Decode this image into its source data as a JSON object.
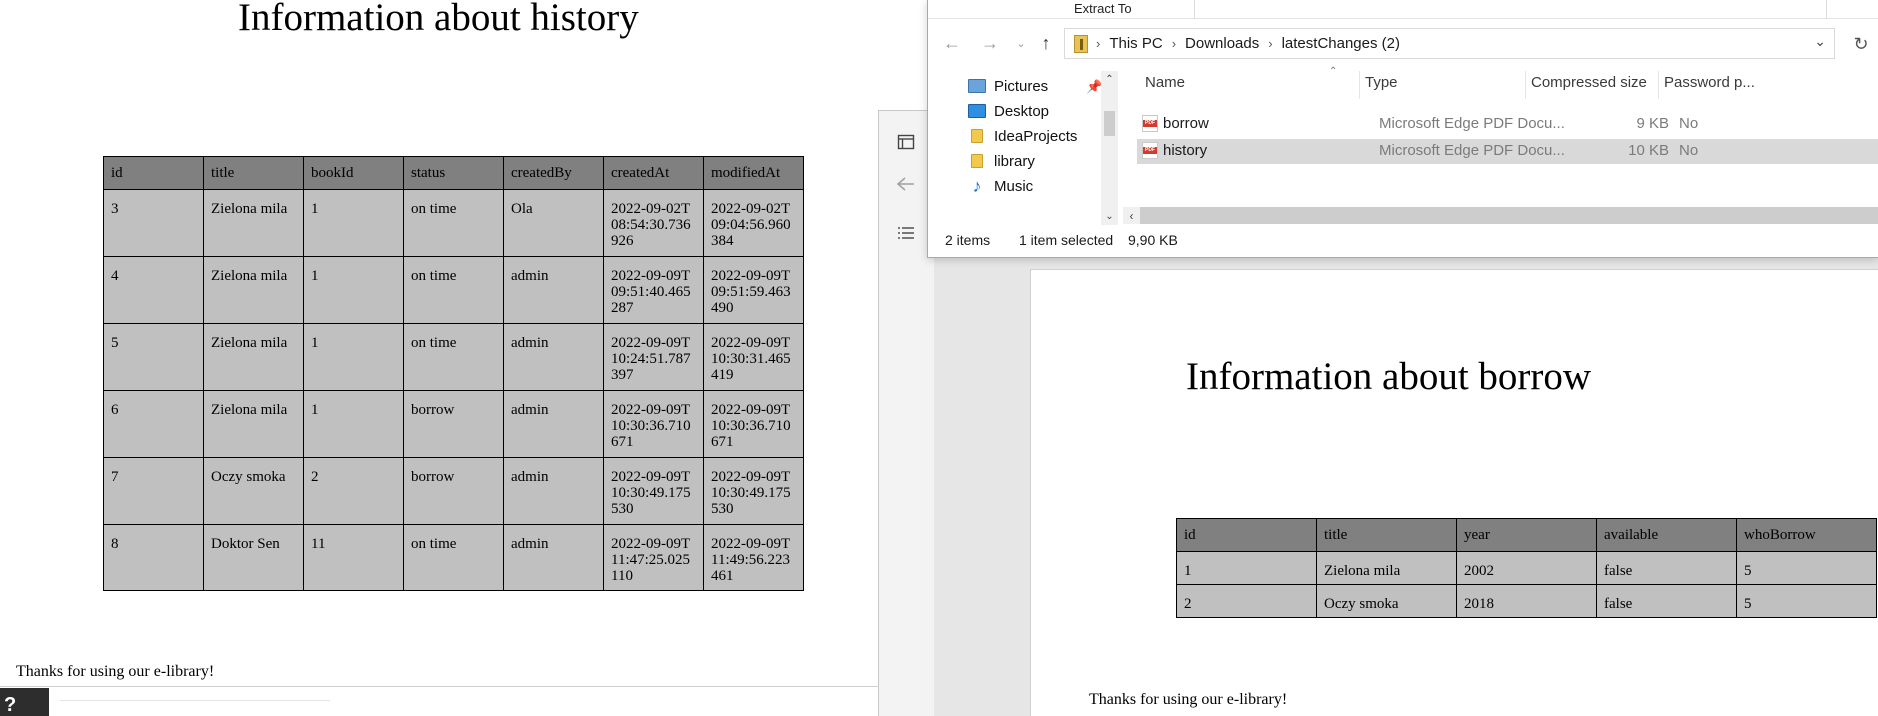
{
  "history_document": {
    "title": "Information about history",
    "columns": [
      "id",
      "title",
      "bookId",
      "status",
      "createdBy",
      "createdAt",
      "modifiedAt"
    ],
    "rows": [
      [
        "3",
        "Zielona mila",
        "1",
        "on time",
        "Ola",
        "2022-09-02T08:54:30.736926",
        "2022-09-02T09:04:56.960384"
      ],
      [
        "4",
        "Zielona mila",
        "1",
        "on time",
        "admin",
        "2022-09-09T09:51:40.465287",
        "2022-09-09T09:51:59.463490"
      ],
      [
        "5",
        "Zielona mila",
        "1",
        "on time",
        "admin",
        "2022-09-09T10:24:51.787397",
        "2022-09-09T10:30:31.465419"
      ],
      [
        "6",
        "Zielona mila",
        "1",
        "borrow",
        "admin",
        "2022-09-09T10:30:36.710671",
        "2022-09-09T10:30:36.710671"
      ],
      [
        "7",
        "Oczy smoka",
        "2",
        "borrow",
        "admin",
        "2022-09-09T10:30:49.175530",
        "2022-09-09T10:30:49.175530"
      ],
      [
        "8",
        "Doktor Sen",
        "11",
        "on time",
        "admin",
        "2022-09-09T11:47:25.025110",
        "2022-09-09T11:49:56.223461"
      ]
    ],
    "footer": "Thanks for using our e-library!"
  },
  "taskbar_fragment": {
    "label": "?"
  },
  "explorer": {
    "ribbon_label": "Extract To",
    "breadcrumb": [
      "This PC",
      "Downloads",
      "latestChanges (2)"
    ],
    "nav_items": [
      {
        "label": "Pictures",
        "icon": "pictures-folder-icon"
      },
      {
        "label": "Desktop",
        "icon": "desktop-folder-icon"
      },
      {
        "label": "IdeaProjects",
        "icon": "folder-icon"
      },
      {
        "label": "library",
        "icon": "folder-icon"
      },
      {
        "label": "Music",
        "icon": "music-icon"
      }
    ],
    "columns": {
      "name": "Name",
      "type": "Type",
      "compressed_size": "Compressed size",
      "password": "Password p..."
    },
    "files": [
      {
        "name": "borrow",
        "type": "Microsoft Edge PDF Docu...",
        "size": "9 KB",
        "password": "No",
        "selected": false
      },
      {
        "name": "history",
        "type": "Microsoft Edge PDF Docu...",
        "size": "10 KB",
        "password": "No",
        "selected": true
      }
    ],
    "status": {
      "items": "2 items",
      "selected": "1 item selected",
      "size": "9,90 KB"
    }
  },
  "borrow_document": {
    "title": "Information about borrow",
    "columns": [
      "id",
      "title",
      "year",
      "available",
      "whoBorrow"
    ],
    "rows": [
      [
        "1",
        "Zielona mila",
        "2002",
        "false",
        "5"
      ],
      [
        "2",
        "Oczy smoka",
        "2018",
        "false",
        "5"
      ]
    ],
    "footer": "Thanks for using our e-library!"
  }
}
